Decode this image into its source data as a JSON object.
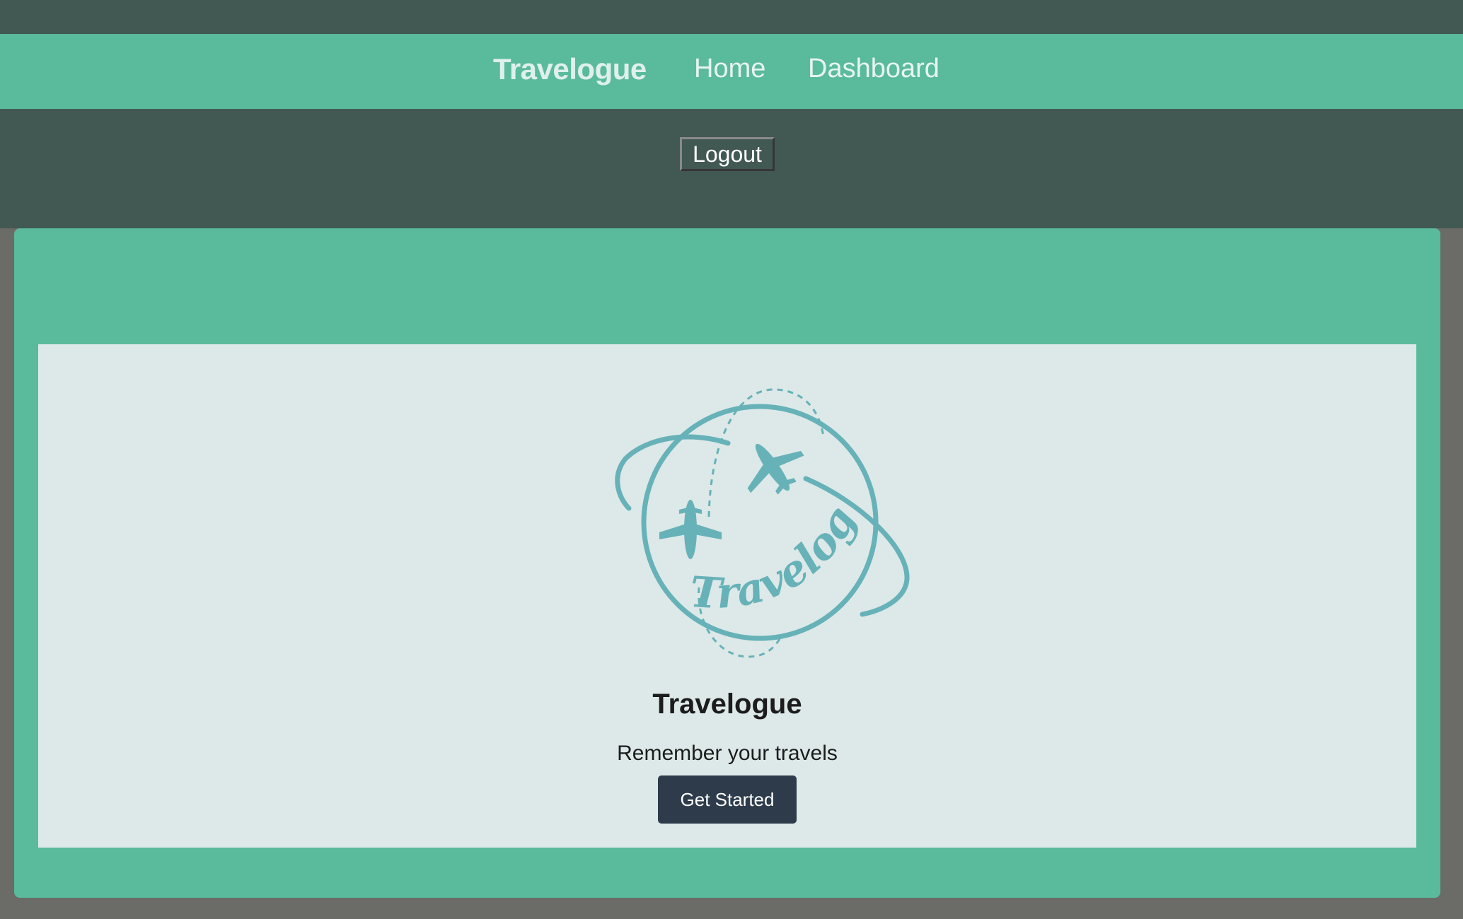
{
  "navbar": {
    "brand": "Travelogue",
    "links": [
      "Home",
      "Dashboard"
    ]
  },
  "subbar": {
    "logout_label": "Logout"
  },
  "hero": {
    "logo_icon": "travelogue-globe-planes-logo",
    "logo_text": "Travelogue",
    "title": "Travelogue",
    "subtitle": "Remember your travels",
    "cta_label": "Get Started"
  },
  "colors": {
    "accent": "#5aba9c",
    "dark_bar": "#425853",
    "hero_bg": "#dde8e8",
    "logo": "#66b2b8",
    "button": "#2d3b4b",
    "page_bg": "#6b6b67"
  }
}
